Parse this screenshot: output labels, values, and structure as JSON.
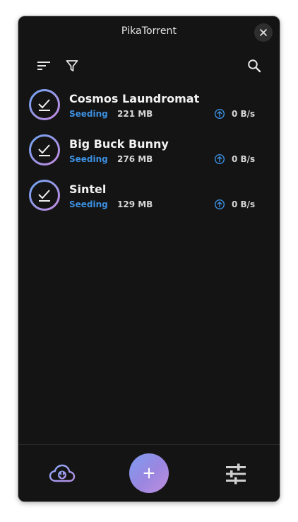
{
  "app": {
    "title": "PikaTorrent"
  },
  "toolbar": {
    "sort_icon": "sort-icon",
    "filter_icon": "filter-icon",
    "search_icon": "search-icon"
  },
  "torrents": [
    {
      "name": "Cosmos Laundromat",
      "status": "Seeding",
      "size": "221 MB",
      "upload_speed": "0 B/s"
    },
    {
      "name": "Big Buck Bunny",
      "status": "Seeding",
      "size": "276 MB",
      "upload_speed": "0 B/s"
    },
    {
      "name": "Sintel",
      "status": "Seeding",
      "size": "129 MB",
      "upload_speed": "0 B/s"
    }
  ],
  "bottom_bar": {
    "left_icon": "cloud-download-icon",
    "center_icon": "add-icon",
    "right_icon": "settings-sliders-icon"
  },
  "colors": {
    "background": "#141414",
    "status_seeding": "#3d8fe0",
    "accent_gradient_start": "#7d9cf0",
    "accent_gradient_end": "#c090e0"
  }
}
